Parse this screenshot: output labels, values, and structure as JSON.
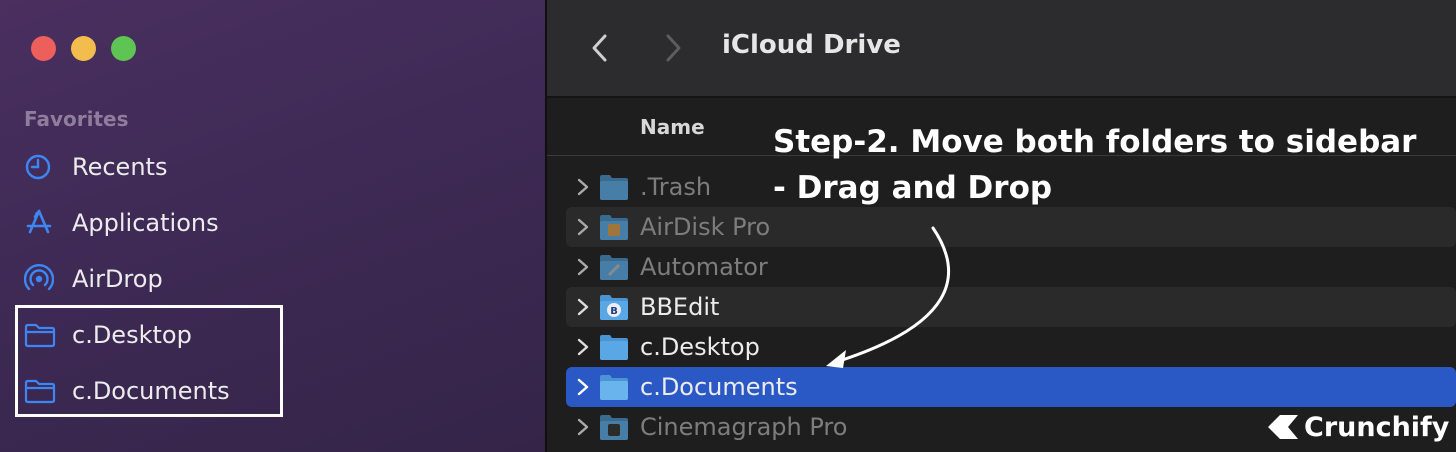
{
  "window": {
    "title": "iCloud Drive"
  },
  "sidebar": {
    "heading": "Favorites",
    "items": [
      {
        "label": "Recents",
        "icon": "clock-icon"
      },
      {
        "label": "Applications",
        "icon": "applications-icon"
      },
      {
        "label": "AirDrop",
        "icon": "airdrop-icon"
      },
      {
        "label": "c.Desktop",
        "icon": "folder-icon"
      },
      {
        "label": "c.Documents",
        "icon": "folder-icon"
      }
    ]
  },
  "list": {
    "column_name": "Name",
    "rows": [
      {
        "label": ".Trash",
        "icon": "folder-icon"
      },
      {
        "label": "AirDisk Pro",
        "icon": "app-folder-icon"
      },
      {
        "label": "Automator",
        "icon": "app-folder-icon"
      },
      {
        "label": "BBEdit",
        "icon": "app-folder-icon"
      },
      {
        "label": "c.Desktop",
        "icon": "folder-icon"
      },
      {
        "label": "c.Documents",
        "icon": "folder-icon"
      },
      {
        "label": "Cinemagraph Pro",
        "icon": "app-folder-icon"
      }
    ]
  },
  "annotation": {
    "line1": "Step-2. Move both folders to sidebar",
    "line2": "- Drag and Drop"
  },
  "watermark": {
    "text": "Crunchify"
  },
  "colors": {
    "accent": "#2a59c6",
    "sidebar_icon": "#3d87f5",
    "folder": "#5aa7e6"
  }
}
